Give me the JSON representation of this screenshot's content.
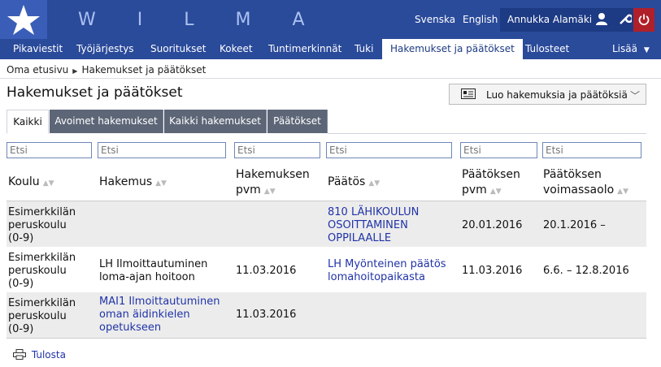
{
  "header": {
    "brand": "W I L M A",
    "lang_sv": "Svenska",
    "lang_en": "English",
    "user_name": "Annukka Alamäki",
    "icons": [
      "star-logo-icon",
      "user-icon",
      "wrench-icon",
      "power-icon"
    ]
  },
  "nav": {
    "items": [
      "Pikaviestit",
      "Työjärjestys",
      "Suoritukset",
      "Kokeet",
      "Tuntimerkinnät",
      "Tuki",
      "Hakemukset ja päätökset",
      "Tulosteet"
    ],
    "active_index": 6,
    "more": "Lisää"
  },
  "breadcrumb": {
    "home": "Oma etusivu",
    "current": "Hakemukset ja päätökset"
  },
  "page": {
    "title": "Hakemukset ja päätökset",
    "action_label": "Luo hakemuksia ja päätöksiä"
  },
  "tabs": [
    "Kaikki",
    "Avoimet hakemukset",
    "Kaikki hakemukset",
    "Päätökset"
  ],
  "filters": {
    "placeholder": "Etsi"
  },
  "table": {
    "headers": {
      "koulu": "Koulu",
      "hakemus": "Hakemus",
      "hakemus_pvm_1": "Hakemuksen",
      "hakemus_pvm_2": "pvm",
      "paatos": "Päätös",
      "paatos_pvm_1": "Päätöksen",
      "paatos_pvm_2": "pvm",
      "voimassa_1": "Päätöksen",
      "voimassa_2": "voimassaolo"
    },
    "rows": [
      {
        "koulu": [
          "Esimerkkilän",
          "peruskoulu",
          "(0-9)"
        ],
        "hakemus": [],
        "hakemus_pvm": "",
        "paatos": [
          "810 LÄHIKOULUN",
          "OSOITTAMINEN",
          "OPPILAALLE"
        ],
        "paatos_pvm": "20.01.2016",
        "voimassa": "20.1.2016 –"
      },
      {
        "koulu": [
          "Esimerkkilän",
          "peruskoulu",
          "(0-9)"
        ],
        "hakemus": [
          "LH Ilmoittautuminen",
          "loma-ajan hoitoon"
        ],
        "hakemus_pvm": "11.03.2016",
        "paatos": [
          "LH Myönteinen päätös",
          "lomahoitopaikasta"
        ],
        "paatos_pvm": "11.03.2016",
        "voimassa": "6.6. – 12.8.2016"
      },
      {
        "koulu": [
          "Esimerkkilän",
          "peruskoulu",
          "(0-9)"
        ],
        "hakemus": [
          "MAI1 Ilmoittautuminen",
          "oman äidinkielen",
          "opetukseen"
        ],
        "hakemus_pvm": "11.03.2016",
        "paatos": [],
        "paatos_pvm": "",
        "voimassa": ""
      }
    ]
  },
  "footer": {
    "print_label": "Tulosta"
  }
}
